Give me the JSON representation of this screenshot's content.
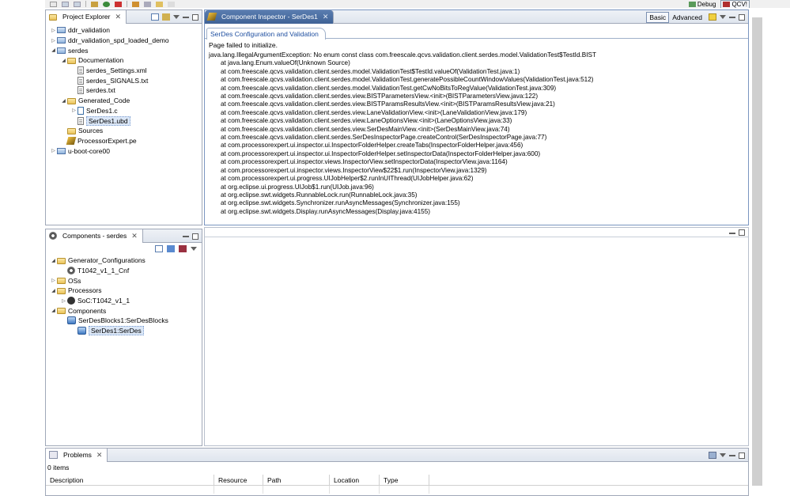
{
  "toolbar": {
    "perspectives": [
      {
        "icon": "debug-perspective-icon",
        "label": "Debug"
      },
      {
        "icon": "qcvs-perspective-icon",
        "label": "QCV!"
      }
    ]
  },
  "project_explorer": {
    "title": "Project Explorer",
    "items": [
      {
        "label": "ddr_validation",
        "level": 0,
        "twisty": "collapsed",
        "icon": "project"
      },
      {
        "label": "ddr_validation_spd_loaded_demo",
        "level": 0,
        "twisty": "collapsed",
        "icon": "project"
      },
      {
        "label": "serdes",
        "level": 0,
        "twisty": "expanded",
        "icon": "project"
      },
      {
        "label": "Documentation",
        "level": 1,
        "twisty": "expanded",
        "icon": "folder"
      },
      {
        "label": "serdes_Settings.xml",
        "level": 2,
        "twisty": "none",
        "icon": "file"
      },
      {
        "label": "serdes_SIGNALS.txt",
        "level": 2,
        "twisty": "none",
        "icon": "file"
      },
      {
        "label": "serdes.txt",
        "level": 2,
        "twisty": "none",
        "icon": "file"
      },
      {
        "label": "Generated_Code",
        "level": 1,
        "twisty": "expanded",
        "icon": "folder"
      },
      {
        "label": "SerDes1.c",
        "level": 2,
        "twisty": "collapsed",
        "icon": "cfile"
      },
      {
        "label": "SerDes1.ubd",
        "level": 2,
        "twisty": "none",
        "icon": "file",
        "selected": true
      },
      {
        "label": "Sources",
        "level": 1,
        "twisty": "none",
        "icon": "folder"
      },
      {
        "label": "ProcessorExpert.pe",
        "level": 1,
        "twisty": "none",
        "icon": "pe"
      },
      {
        "label": "u-boot-core00",
        "level": 0,
        "twisty": "collapsed",
        "icon": "project"
      }
    ]
  },
  "components": {
    "title": "Components - serdes",
    "items": [
      {
        "label": "Generator_Configurations",
        "level": 0,
        "twisty": "expanded",
        "icon": "folder"
      },
      {
        "label": "T1042_v1_1_Cnf",
        "level": 1,
        "twisty": "none",
        "icon": "gear"
      },
      {
        "label": "OSs",
        "level": 0,
        "twisty": "collapsed",
        "icon": "folder"
      },
      {
        "label": "Processors",
        "level": 0,
        "twisty": "expanded",
        "icon": "folder"
      },
      {
        "label": "SoC:T1042_v1_1",
        "level": 1,
        "twisty": "collapsed",
        "icon": "chip"
      },
      {
        "label": "Components",
        "level": 0,
        "twisty": "expanded",
        "icon": "folder"
      },
      {
        "label": "SerDesBlocks1:SerDesBlocks",
        "level": 1,
        "twisty": "none",
        "icon": "comp"
      },
      {
        "label": "SerDes1:SerDes",
        "level": 2,
        "twisty": "none",
        "icon": "comp",
        "selected": true
      }
    ]
  },
  "inspector": {
    "title": "Component Inspector - SerDes1",
    "mode_basic": "Basic",
    "mode_advanced": "Advanced",
    "inner_tab": "SerDes Configuration and Validation",
    "fail_message": "Page failed to initialize.",
    "trace": [
      "java.lang.IllegalArgumentException: No enum const class com.freescale.qcvs.validation.client.serdes.model.ValidationTest$TestId.BIST",
      "at java.lang.Enum.valueOf(Unknown Source)",
      "at com.freescale.qcvs.validation.client.serdes.model.ValidationTest$TestId.valueOf(ValidationTest.java:1)",
      "at com.freescale.qcvs.validation.client.serdes.model.ValidationTest.generatePossibleCountWindowValues(ValidationTest.java:512)",
      "at com.freescale.qcvs.validation.client.serdes.model.ValidationTest.getCwNoBitsToRegValue(ValidationTest.java:309)",
      "at com.freescale.qcvs.validation.client.serdes.view.BISTParametersView.<init>(BISTParametersView.java:122)",
      "at com.freescale.qcvs.validation.client.serdes.view.BISTParamsResultsView.<init>(BISTParamsResultsView.java:21)",
      "at com.freescale.qcvs.validation.client.serdes.view.LaneValidationView.<init>(LaneValidationView.java:179)",
      "at com.freescale.qcvs.validation.client.serdes.view.LaneOptionsView.<init>(LaneOptionsView.java:33)",
      "at com.freescale.qcvs.validation.client.serdes.view.SerDesMainView.<init>(SerDesMainView.java:74)",
      "at com.freescale.qcvs.validation.client.serdes.SerDesInspectorPage.createControl(SerDesInspectorPage.java:77)",
      "at com.processorexpert.ui.inspector.ui.InspectorFolderHelper.createTabs(InspectorFolderHelper.java:456)",
      "at com.processorexpert.ui.inspector.ui.InspectorFolderHelper.setInspectorData(InspectorFolderHelper.java:600)",
      "at com.processorexpert.ui.inspector.views.InspectorView.setInspectorData(InspectorView.java:1164)",
      "at com.processorexpert.ui.inspector.views.InspectorView$22$1.run(InspectorView.java:1329)",
      "at com.processorexpert.ui.progress.UIJobHelper$2.runInUIThread(UIJobHelper.java:62)",
      "at org.eclipse.ui.progress.UIJob$1.run(UIJob.java:96)",
      "at org.eclipse.swt.widgets.RunnableLock.run(RunnableLock.java:35)",
      "at org.eclipse.swt.widgets.Synchronizer.runAsyncMessages(Synchronizer.java:155)",
      "at org.eclipse.swt.widgets.Display.runAsyncMessages(Display.java:4155)"
    ]
  },
  "problems": {
    "title": "Problems",
    "count": "0 items",
    "columns": [
      "Description",
      "Resource",
      "Path",
      "Location",
      "Type"
    ]
  },
  "colors": {
    "panel_border": "#a0a8b8",
    "link_blue": "#1f4fa0",
    "editor_tab": "#4a6ea4"
  }
}
